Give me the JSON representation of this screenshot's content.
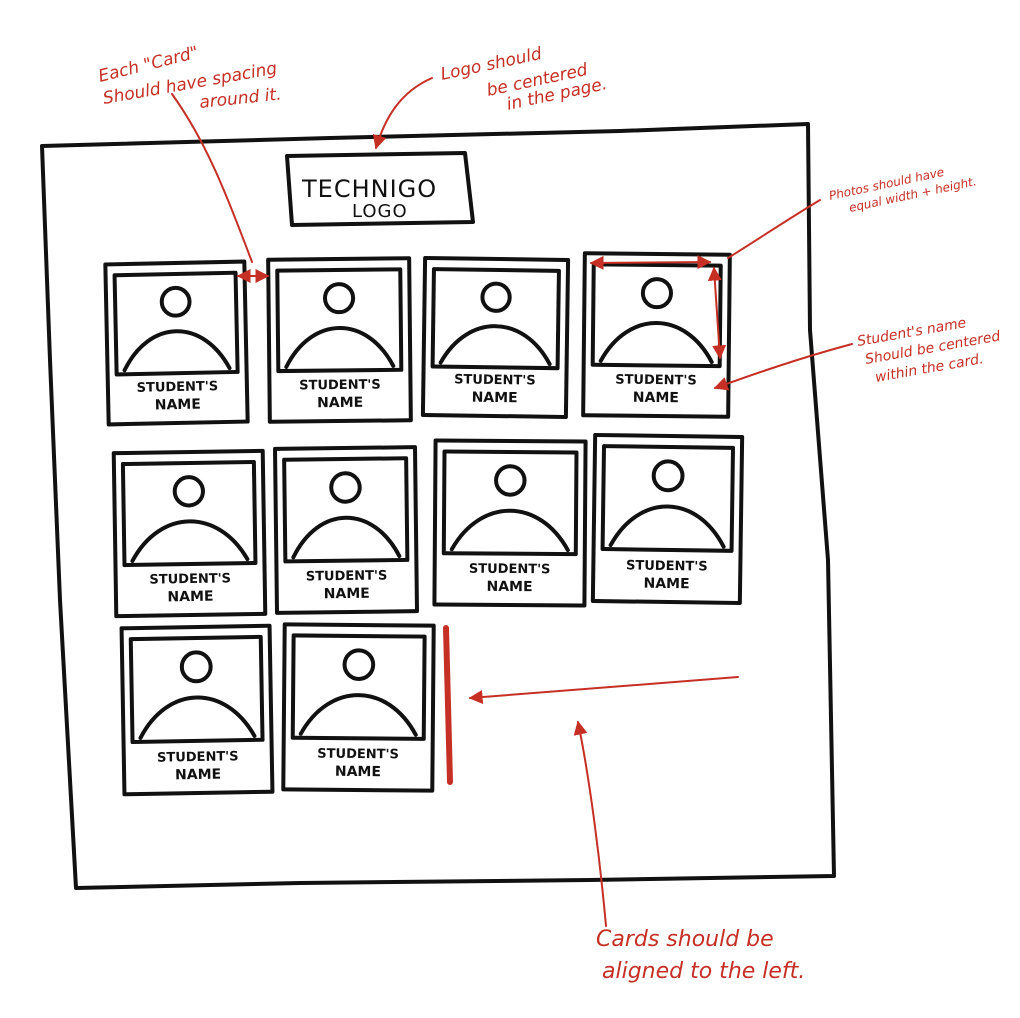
{
  "logo": {
    "line1": "TECHNIGO",
    "line2": "LOGO"
  },
  "cards": [
    {
      "name_line1": "STUDENT'S",
      "name_line2": "NAME"
    },
    {
      "name_line1": "STUDENT'S",
      "name_line2": "NAME"
    },
    {
      "name_line1": "STUDENT'S",
      "name_line2": "NAME"
    },
    {
      "name_line1": "STUDENT'S",
      "name_line2": "NAME"
    },
    {
      "name_line1": "STUDENT'S",
      "name_line2": "NAME"
    },
    {
      "name_line1": "STUDENT'S",
      "name_line2": "NAME"
    },
    {
      "name_line1": "STUDENT'S",
      "name_line2": "NAME"
    },
    {
      "name_line1": "STUDENT'S",
      "name_line2": "NAME"
    },
    {
      "name_line1": "STUDENT'S",
      "name_line2": "NAME"
    },
    {
      "name_line1": "STUDENT'S",
      "name_line2": "NAME"
    }
  ],
  "annotations": {
    "card_spacing": [
      "Each \"Card\"",
      "Should have spacing",
      "around it."
    ],
    "logo_centered": [
      "Logo should",
      "be centered",
      "in the page."
    ],
    "photo_square": [
      "Photos should have",
      "equal width + height."
    ],
    "name_centered": [
      "Student's name",
      "Should be centered",
      "within the card."
    ],
    "left_aligned": [
      "Cards should be",
      "aligned to the left."
    ]
  },
  "colors": {
    "ink": "#111111",
    "annotation": "#c62f24"
  }
}
